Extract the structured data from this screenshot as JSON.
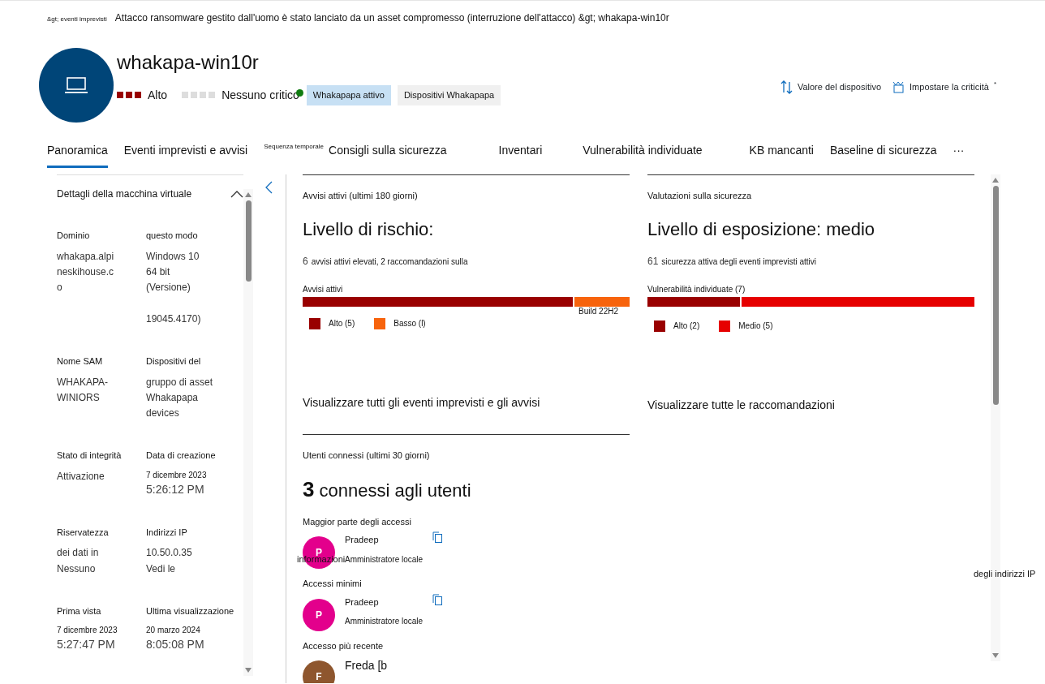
{
  "breadcrumb": {
    "parent": "&gt; eventi imprevisti",
    "path": "Attacco ransomware gestito dall'uomo è stato lanciato da un asset compromesso (interruzione dell'attacco) &gt; whakapa-win10r"
  },
  "device": {
    "name": "whakapa-win10r",
    "risk": {
      "label": "Alto",
      "squares": [
        {
          "on": true
        },
        {
          "on": true
        },
        {
          "on": true
        }
      ]
    },
    "criticality": {
      "label": "Nessuno critico",
      "squares": [
        {
          "on": false
        },
        {
          "on": false
        },
        {
          "on": false
        },
        {
          "on": false
        }
      ]
    },
    "status": {
      "color": "#107c10"
    },
    "tags": [
      {
        "label": "Whakapapa attivo",
        "selected": true
      },
      {
        "label": "Dispositivi Whakapapa",
        "selected": false
      }
    ]
  },
  "actions": [
    {
      "kind": "sort",
      "label": "Valore del dispositivo"
    },
    {
      "kind": "criticality",
      "label": "Impostare la criticità",
      "marker": "*"
    }
  ],
  "tabs": [
    {
      "label": "Panoramica",
      "kind": "normal",
      "selected": true
    },
    {
      "label": "Eventi imprevisti e avvisi",
      "kind": "normal",
      "selected": false
    },
    {
      "label": "Sequenza temporale",
      "kind": "small",
      "selected": false
    },
    {
      "label": "Consigli sulla sicurezza",
      "kind": "normal",
      "selected": false
    },
    {
      "label": "Inventari",
      "kind": "normal",
      "selected": false
    },
    {
      "label": "Vulnerabilità individuate",
      "kind": "normal",
      "selected": false
    },
    {
      "label": "KB mancanti",
      "kind": "normal",
      "selected": false
    },
    {
      "label": "Baseline di sicurezza",
      "kind": "normal",
      "selected": false
    }
  ],
  "tabs_more": "···",
  "sidebar": {
    "title": "Dettagli della macchina virtuale",
    "expanded": true,
    "rows": [
      [
        {
          "label": "Dominio",
          "values": [
            "whakapa.alpi",
            "neskihouse.c",
            "o"
          ]
        },
        {
          "label": "questo modo",
          "values": [
            "Windows 10",
            "64 bit",
            "(Versione)",
            "19045.4170)"
          ]
        }
      ],
      [
        {
          "label": "Nome SAM",
          "values": [
            "WHAKAPA-",
            "WINIORS"
          ]
        },
        {
          "label": "Dispositivi del",
          "values": [
            "gruppo di asset Whakapapa",
            "devices"
          ]
        }
      ],
      [
        {
          "label": "Stato di integrità",
          "values": [
            "Attivazione"
          ]
        },
        {
          "label": "Data di creazione",
          "date": "7 dicembre 2023",
          "time": "5:26:12 PM"
        }
      ],
      [
        {
          "label": "Riservatezza",
          "values": [
            "dei dati in",
            "Nessuno"
          ]
        },
        {
          "label": "Indirizzi IP",
          "values": [
            "10.50.0.35"
          ],
          "link": "Vedi le"
        }
      ],
      [
        {
          "label": "Prima vista",
          "date": "7 dicembre 2023",
          "time": "5:27:47 PM"
        },
        {
          "label": "Ultima visualizzazione",
          "date": "20 marzo 2024",
          "time": "8:05:08 PM"
        }
      ]
    ]
  },
  "cards": [
    {
      "title": "Avvisi attivi (ultimi 180 giorni)",
      "heading": "Livello di rischio:",
      "count": "6",
      "summary": "avvisi attivi elevati, 2 raccomandazioni sulla",
      "bar_label": "Avvisi attivi",
      "segments": [
        {
          "label": "Alto (5)",
          "color": "#990000",
          "level": 0.83
        },
        {
          "label": "Basso (l)",
          "color": "#f7630c",
          "level": 0.17
        }
      ],
      "note": "Build 22H2",
      "link": "Visualizzare tutti gli eventi imprevisti e gli avvisi"
    },
    {
      "title": "Valutazioni sulla sicurezza",
      "heading": "Livello di esposizione: medio",
      "count": "61",
      "summary": "sicurezza attiva degli eventi imprevisti attivi",
      "bar_label": "Vulnerabilità individuate (7)",
      "segments": [
        {
          "label": "Alto (2)",
          "color": "#990000",
          "level": 0.285
        },
        {
          "label": "Medio (5)",
          "color": "#e60000",
          "level": 0.715
        }
      ],
      "link": "Visualizzare tutte le raccomandazioni"
    }
  ],
  "users": {
    "title": "Utenti connessi (ultimi 30 giorni)",
    "count": "3",
    "heading": "connessi agli utenti",
    "groups": [
      {
        "heading": "Maggior parte degli accessi",
        "initial": "P",
        "color": "#e3008c",
        "name": "Pradeep",
        "role": "Amministratore locale",
        "copy": true
      },
      {
        "heading": "Accessi minimi",
        "initial": "P",
        "color": "#e3008c",
        "name": "Pradeep",
        "role": "Amministratore locale",
        "copy": true
      },
      {
        "heading": "Accesso più recente",
        "initial": "F",
        "color": "#8e562e",
        "name": "Freda [b",
        "copy": false
      }
    ]
  },
  "stray_texts": [
    "informazioni",
    "degli indirizzi IP"
  ]
}
